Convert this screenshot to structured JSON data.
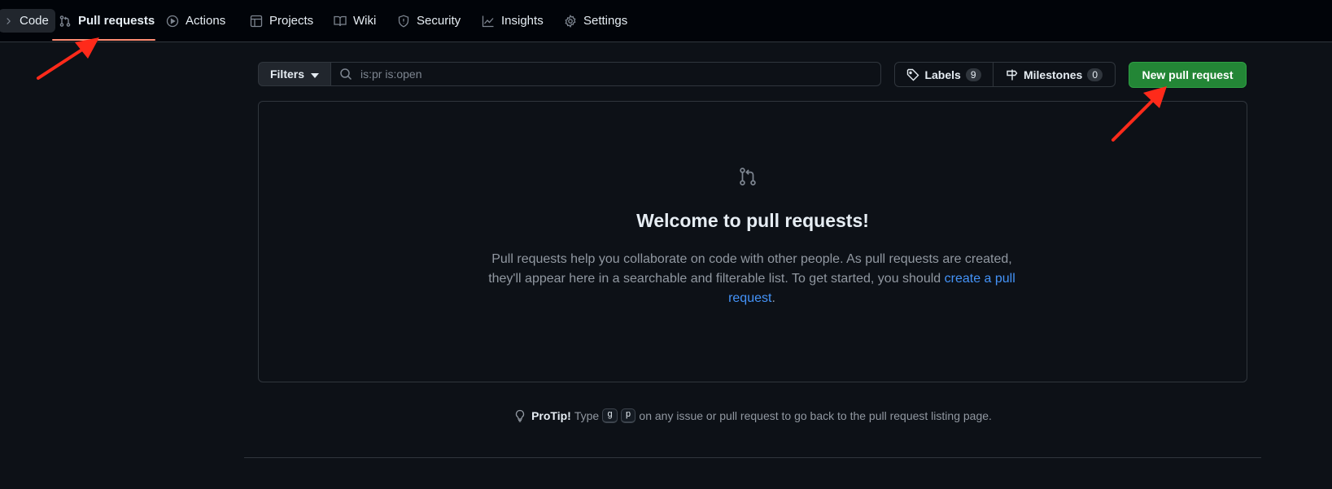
{
  "nav": {
    "tabs": [
      {
        "label": "Code",
        "icon": "code-icon"
      },
      {
        "label": "Pull requests",
        "icon": "git-pull-request-icon"
      },
      {
        "label": "Actions",
        "icon": "play-icon"
      },
      {
        "label": "Projects",
        "icon": "table-icon"
      },
      {
        "label": "Wiki",
        "icon": "book-icon"
      },
      {
        "label": "Security",
        "icon": "shield-icon"
      },
      {
        "label": "Insights",
        "icon": "graph-icon"
      },
      {
        "label": "Settings",
        "icon": "gear-icon"
      }
    ],
    "selected": "Pull requests"
  },
  "toolbar": {
    "filters_label": "Filters",
    "search_value": "is:pr is:open",
    "labels_label": "Labels",
    "labels_count": "9",
    "milestones_label": "Milestones",
    "milestones_count": "0",
    "new_pr_label": "New pull request"
  },
  "blankslate": {
    "title": "Welcome to pull requests!",
    "desc_before": "Pull requests help you collaborate on code with other people. As pull requests are created, they'll appear here in a searchable and filterable list. To get started, you should ",
    "desc_link": "create a pull request",
    "desc_after": "."
  },
  "protip": {
    "label": "ProTip!",
    "before": "Type",
    "key1": "g",
    "key2": "p",
    "after": "on any issue or pull request to go back to the pull request listing page."
  },
  "colors": {
    "accent_underline": "#fd8c73",
    "primary_button": "#238636",
    "link": "#4493f8",
    "annotation_arrow": "#ff2a1a"
  }
}
